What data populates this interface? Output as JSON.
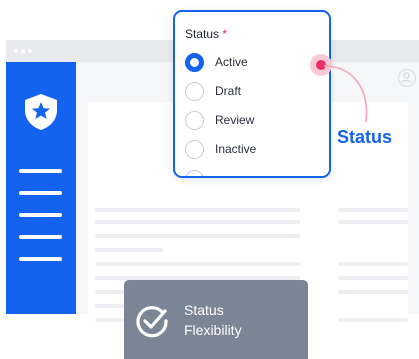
{
  "status_field": {
    "label": "Status",
    "required_mark": "*",
    "options": [
      {
        "label": "Active",
        "selected": true
      },
      {
        "label": "Draft",
        "selected": false
      },
      {
        "label": "Review",
        "selected": false
      },
      {
        "label": "Inactive",
        "selected": false
      }
    ]
  },
  "callout": {
    "label": "Status"
  },
  "badge": {
    "line1": "Status",
    "line2": "Flexibility"
  },
  "icons": {
    "sidebar_logo": "shield-star-icon",
    "badge": "checkmark-circle-icon",
    "avatar": "user-avatar-icon"
  },
  "colors": {
    "accent": "#1463ee",
    "pointer": "#e8306a",
    "required": "#e2334f",
    "badge_bg": "#7a8596"
  }
}
